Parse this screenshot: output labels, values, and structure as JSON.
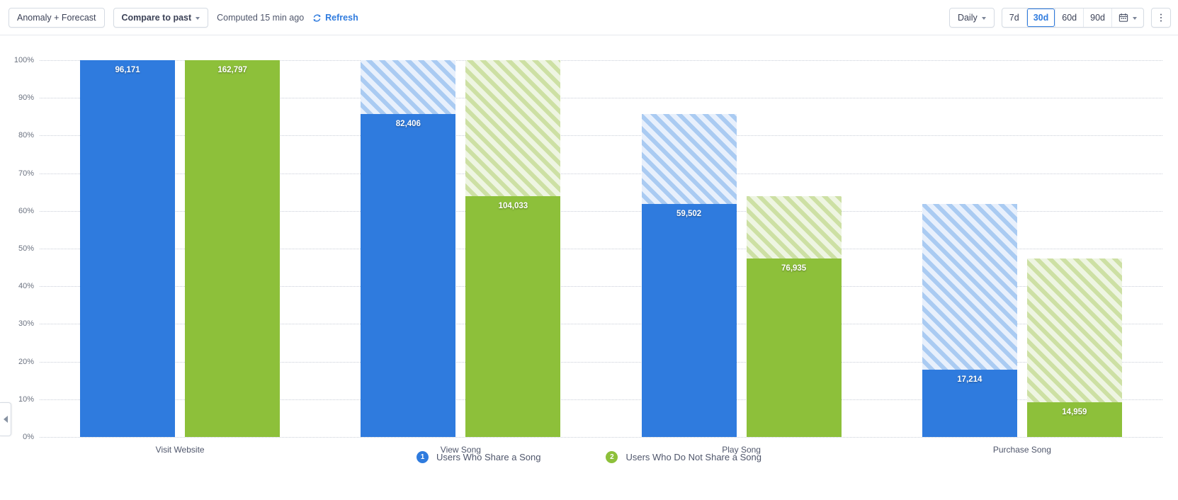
{
  "toolbar": {
    "anomaly_forecast_label": "Anomaly + Forecast",
    "compare_label": "Compare to past",
    "computed_text": "Computed 15 min ago",
    "refresh_label": "Refresh",
    "granularity_label": "Daily",
    "ranges": [
      {
        "label": "7d",
        "active": false
      },
      {
        "label": "30d",
        "active": true
      },
      {
        "label": "60d",
        "active": false
      },
      {
        "label": "90d",
        "active": false
      }
    ]
  },
  "colors": {
    "blue": "#2f7bde",
    "blue_hatch_base": "#e8f0fc",
    "blue_hatch_stripe": "#aacbf2",
    "green": "#8dc03a",
    "green_hatch_base": "#eef5e2",
    "green_hatch_stripe": "#cde0a4",
    "accent": "#2f7bde",
    "gridline": "#c9ced8"
  },
  "legend": [
    {
      "badge": "1",
      "label": "Users Who Share a Song",
      "color": "#2f7bde"
    },
    {
      "badge": "2",
      "label": "Users Who Do Not Share a Song",
      "color": "#8dc03a"
    }
  ],
  "chart_data": {
    "type": "bar",
    "title": "",
    "subtitle": "",
    "xlabel": "",
    "ylabel": "",
    "ylim": [
      0,
      100
    ],
    "grid": true,
    "legend_position": "bottom",
    "stacked": "funnel-dropoff",
    "yticks": [
      "0%",
      "10%",
      "20%",
      "30%",
      "40%",
      "50%",
      "60%",
      "70%",
      "80%",
      "90%",
      "100%"
    ],
    "ytick_values": [
      0,
      10,
      20,
      30,
      40,
      50,
      60,
      70,
      80,
      90,
      100
    ],
    "categories": [
      "Visit Website",
      "View Song",
      "Play Song",
      "Purchase Song"
    ],
    "series": [
      {
        "name": "Users Who Share a Song",
        "color": "#2f7bde",
        "values": [
          96171,
          82406,
          59502,
          17214
        ],
        "labels": [
          "96,171",
          "82,406",
          "59,502",
          "17,214"
        ],
        "retained_pct": [
          100.0,
          85.7,
          61.9,
          17.9
        ],
        "dropoff_top_pct": [
          100.0,
          100.0,
          85.7,
          61.9
        ]
      },
      {
        "name": "Users Who Do Not Share a Song",
        "color": "#8dc03a",
        "values": [
          162797,
          104033,
          76935,
          14959
        ],
        "labels": [
          "162,797",
          "104,033",
          "76,935",
          "14,959"
        ],
        "retained_pct": [
          100.0,
          63.9,
          47.3,
          9.2
        ],
        "dropoff_top_pct": [
          100.0,
          100.0,
          63.9,
          47.3
        ]
      }
    ]
  }
}
